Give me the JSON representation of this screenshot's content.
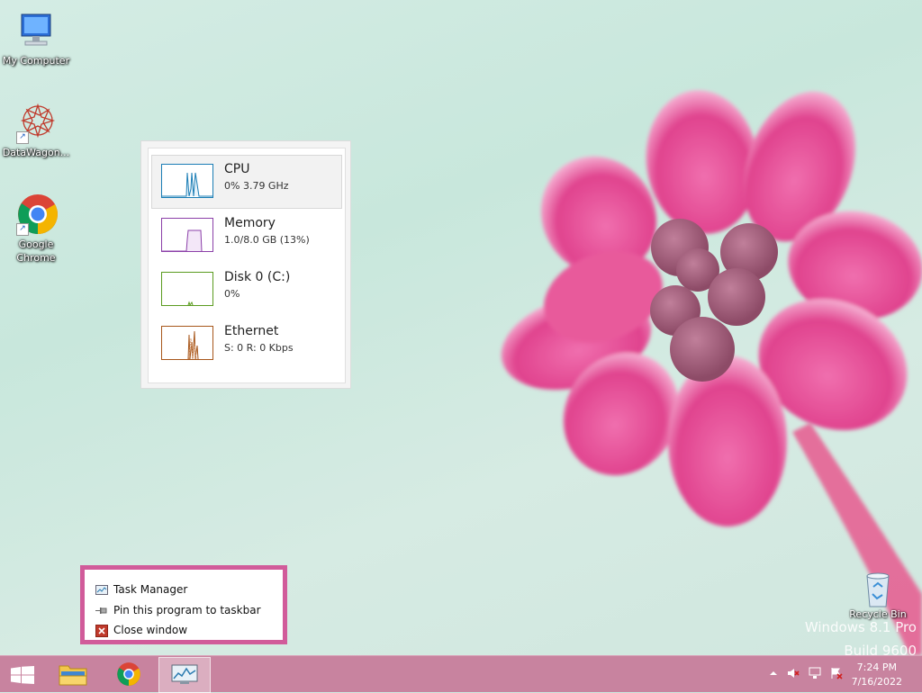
{
  "desktop": {
    "icons": [
      {
        "label": "My Computer"
      },
      {
        "label": "DataWagon..."
      },
      {
        "label": "Google Chrome"
      }
    ],
    "recycle_bin": {
      "label": "Recycle Bin"
    },
    "watermark": {
      "line1": "Windows 8.1 Pro",
      "line2": "Build 9600"
    }
  },
  "task_manager": {
    "rows": [
      {
        "name": "CPU",
        "detail": "0% 3.79 GHz",
        "color": "#1a7db5"
      },
      {
        "name": "Memory",
        "detail": "1.0/8.0 GB (13%)",
        "color": "#8b3fa8"
      },
      {
        "name": "Disk 0 (C:)",
        "detail": "0%",
        "color": "#5a9b1f"
      },
      {
        "name": "Ethernet",
        "detail": "S: 0 R: 0 Kbps",
        "color": "#a7561a"
      }
    ]
  },
  "jump_list": {
    "items": [
      {
        "label": "Task Manager",
        "icon": "task-manager-icon"
      },
      {
        "label": "Pin this program to taskbar",
        "icon": "pin-icon"
      },
      {
        "label": "Close window",
        "icon": "close-icon"
      }
    ]
  },
  "taskbar": {
    "clock": {
      "time": "7:24 PM",
      "date": "7/16/2022"
    },
    "buttons": [
      "start-button",
      "file-explorer",
      "chrome",
      "task-manager"
    ]
  },
  "colors": {
    "taskbar": "#c8839f",
    "accent": "#d15b9a"
  }
}
